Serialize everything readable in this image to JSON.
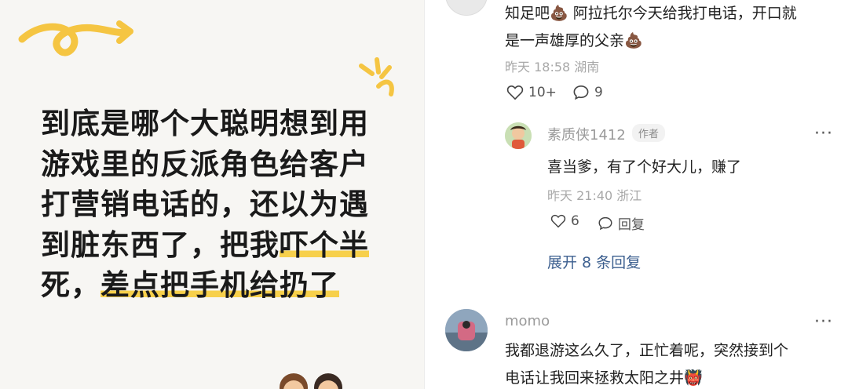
{
  "post": {
    "lines_plain": [
      "到底是哪个大聪明想到用",
      "游戏里的反派角色给客户",
      "打营销电话的，还以为遇",
      "到脏东西了，把我"
    ],
    "line4_highlight": "吓个半",
    "line5_pre": "死，",
    "line5_highlight": "差点把手机给扔了"
  },
  "comments": {
    "top": {
      "text_line1": "知足吧💩 阿拉托尔今天给我打电话，开口就",
      "text_line2": "是一声雄厚的父亲💩",
      "time": "昨天 18:58 湖南",
      "likes": "10+",
      "replies": "9"
    },
    "reply": {
      "username": "素质侠1412",
      "badge": "作者",
      "text": "喜当爹，有了个好大儿，赚了",
      "time": "昨天 21:40 浙江",
      "likes": "6",
      "reply_label": "回复"
    },
    "expand_label": "展开 8 条回复",
    "third": {
      "username": "momo",
      "text_line1": "我都退游这么久了，正忙着呢，突然接到个",
      "text_line2": "电话让我回来拯救太阳之井👹"
    }
  },
  "icons": {
    "like": "heart-icon",
    "comment": "comment-bubble-icon",
    "more": "more-dots-icon"
  },
  "colors": {
    "highlight": "#f7d04b",
    "link": "#3c5f8f",
    "deco": "#f5c542"
  }
}
